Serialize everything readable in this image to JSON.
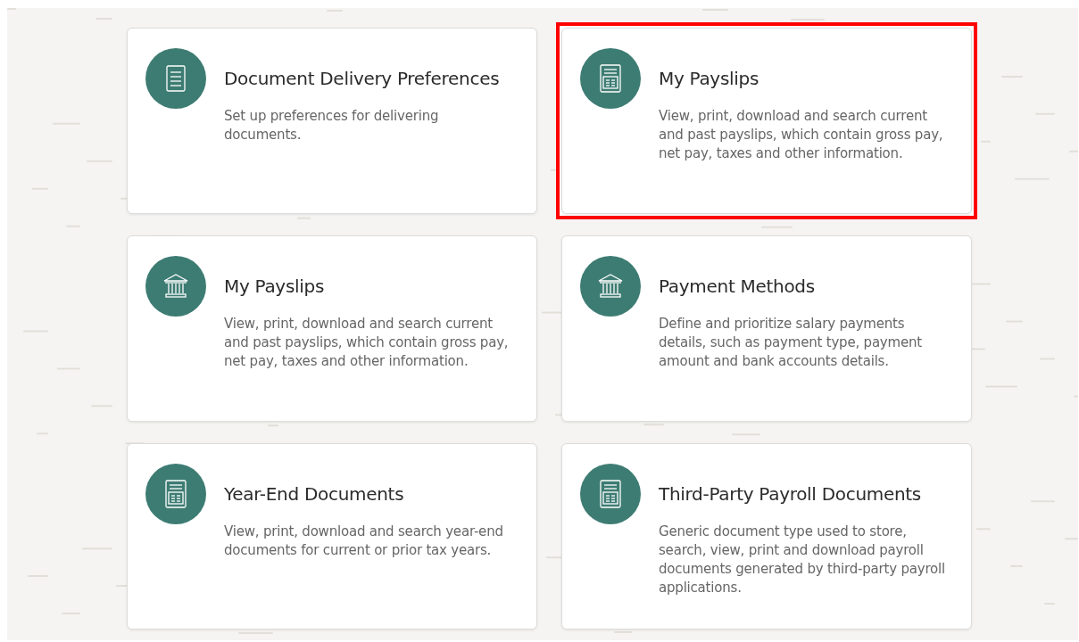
{
  "cards": [
    {
      "kind": "document",
      "title": "Document Delivery Preferences",
      "description": "Set up preferences for delivering documents.",
      "highlighted": false
    },
    {
      "kind": "calculator",
      "title": "My Payslips",
      "description": "View, print, download and search current and past payslips, which contain gross pay, net pay, taxes and other information.",
      "highlighted": true
    },
    {
      "kind": "bank",
      "title": "My Payslips",
      "description": "View, print, download and search current and past payslips, which contain gross pay, net pay, taxes and other information.",
      "highlighted": false
    },
    {
      "kind": "bank",
      "title": "Payment Methods",
      "description": "Define and prioritize salary payments details, such as payment type, payment amount and bank accounts details.",
      "highlighted": false
    },
    {
      "kind": "calculator",
      "title": "Year-End Documents",
      "description": "View, print, download and search year-end documents for current or prior tax years.",
      "highlighted": false
    },
    {
      "kind": "calculator",
      "title": "Third-Party Payroll Documents",
      "description": "Generic document type used to store, search, view, print and download payroll documents generated by third-party payroll applications.",
      "highlighted": false
    }
  ]
}
